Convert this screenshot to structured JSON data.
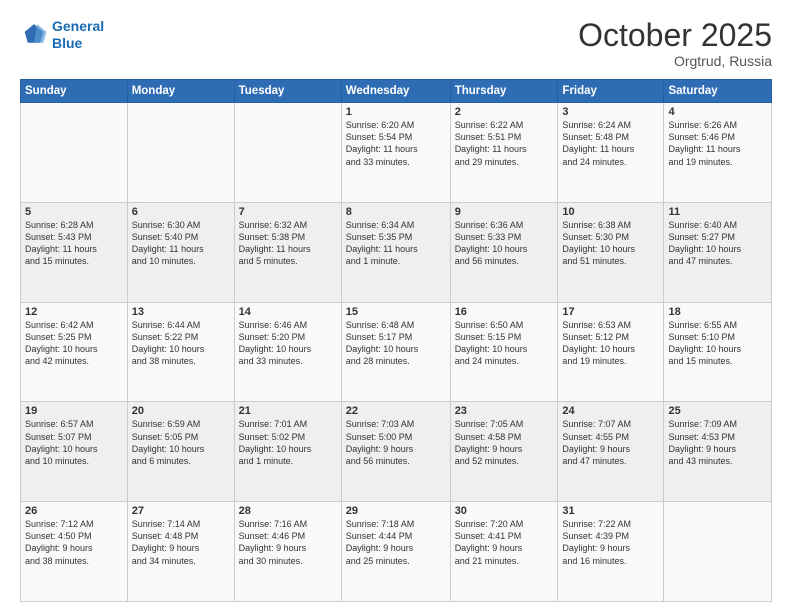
{
  "header": {
    "logo_line1": "General",
    "logo_line2": "Blue",
    "month": "October 2025",
    "location": "Orgtrud, Russia"
  },
  "days_of_week": [
    "Sunday",
    "Monday",
    "Tuesday",
    "Wednesday",
    "Thursday",
    "Friday",
    "Saturday"
  ],
  "weeks": [
    [
      {
        "day": "",
        "text": ""
      },
      {
        "day": "",
        "text": ""
      },
      {
        "day": "",
        "text": ""
      },
      {
        "day": "1",
        "text": "Sunrise: 6:20 AM\nSunset: 5:54 PM\nDaylight: 11 hours\nand 33 minutes."
      },
      {
        "day": "2",
        "text": "Sunrise: 6:22 AM\nSunset: 5:51 PM\nDaylight: 11 hours\nand 29 minutes."
      },
      {
        "day": "3",
        "text": "Sunrise: 6:24 AM\nSunset: 5:48 PM\nDaylight: 11 hours\nand 24 minutes."
      },
      {
        "day": "4",
        "text": "Sunrise: 6:26 AM\nSunset: 5:46 PM\nDaylight: 11 hours\nand 19 minutes."
      }
    ],
    [
      {
        "day": "5",
        "text": "Sunrise: 6:28 AM\nSunset: 5:43 PM\nDaylight: 11 hours\nand 15 minutes."
      },
      {
        "day": "6",
        "text": "Sunrise: 6:30 AM\nSunset: 5:40 PM\nDaylight: 11 hours\nand 10 minutes."
      },
      {
        "day": "7",
        "text": "Sunrise: 6:32 AM\nSunset: 5:38 PM\nDaylight: 11 hours\nand 5 minutes."
      },
      {
        "day": "8",
        "text": "Sunrise: 6:34 AM\nSunset: 5:35 PM\nDaylight: 11 hours\nand 1 minute."
      },
      {
        "day": "9",
        "text": "Sunrise: 6:36 AM\nSunset: 5:33 PM\nDaylight: 10 hours\nand 56 minutes."
      },
      {
        "day": "10",
        "text": "Sunrise: 6:38 AM\nSunset: 5:30 PM\nDaylight: 10 hours\nand 51 minutes."
      },
      {
        "day": "11",
        "text": "Sunrise: 6:40 AM\nSunset: 5:27 PM\nDaylight: 10 hours\nand 47 minutes."
      }
    ],
    [
      {
        "day": "12",
        "text": "Sunrise: 6:42 AM\nSunset: 5:25 PM\nDaylight: 10 hours\nand 42 minutes."
      },
      {
        "day": "13",
        "text": "Sunrise: 6:44 AM\nSunset: 5:22 PM\nDaylight: 10 hours\nand 38 minutes."
      },
      {
        "day": "14",
        "text": "Sunrise: 6:46 AM\nSunset: 5:20 PM\nDaylight: 10 hours\nand 33 minutes."
      },
      {
        "day": "15",
        "text": "Sunrise: 6:48 AM\nSunset: 5:17 PM\nDaylight: 10 hours\nand 28 minutes."
      },
      {
        "day": "16",
        "text": "Sunrise: 6:50 AM\nSunset: 5:15 PM\nDaylight: 10 hours\nand 24 minutes."
      },
      {
        "day": "17",
        "text": "Sunrise: 6:53 AM\nSunset: 5:12 PM\nDaylight: 10 hours\nand 19 minutes."
      },
      {
        "day": "18",
        "text": "Sunrise: 6:55 AM\nSunset: 5:10 PM\nDaylight: 10 hours\nand 15 minutes."
      }
    ],
    [
      {
        "day": "19",
        "text": "Sunrise: 6:57 AM\nSunset: 5:07 PM\nDaylight: 10 hours\nand 10 minutes."
      },
      {
        "day": "20",
        "text": "Sunrise: 6:59 AM\nSunset: 5:05 PM\nDaylight: 10 hours\nand 6 minutes."
      },
      {
        "day": "21",
        "text": "Sunrise: 7:01 AM\nSunset: 5:02 PM\nDaylight: 10 hours\nand 1 minute."
      },
      {
        "day": "22",
        "text": "Sunrise: 7:03 AM\nSunset: 5:00 PM\nDaylight: 9 hours\nand 56 minutes."
      },
      {
        "day": "23",
        "text": "Sunrise: 7:05 AM\nSunset: 4:58 PM\nDaylight: 9 hours\nand 52 minutes."
      },
      {
        "day": "24",
        "text": "Sunrise: 7:07 AM\nSunset: 4:55 PM\nDaylight: 9 hours\nand 47 minutes."
      },
      {
        "day": "25",
        "text": "Sunrise: 7:09 AM\nSunset: 4:53 PM\nDaylight: 9 hours\nand 43 minutes."
      }
    ],
    [
      {
        "day": "26",
        "text": "Sunrise: 7:12 AM\nSunset: 4:50 PM\nDaylight: 9 hours\nand 38 minutes."
      },
      {
        "day": "27",
        "text": "Sunrise: 7:14 AM\nSunset: 4:48 PM\nDaylight: 9 hours\nand 34 minutes."
      },
      {
        "day": "28",
        "text": "Sunrise: 7:16 AM\nSunset: 4:46 PM\nDaylight: 9 hours\nand 30 minutes."
      },
      {
        "day": "29",
        "text": "Sunrise: 7:18 AM\nSunset: 4:44 PM\nDaylight: 9 hours\nand 25 minutes."
      },
      {
        "day": "30",
        "text": "Sunrise: 7:20 AM\nSunset: 4:41 PM\nDaylight: 9 hours\nand 21 minutes."
      },
      {
        "day": "31",
        "text": "Sunrise: 7:22 AM\nSunset: 4:39 PM\nDaylight: 9 hours\nand 16 minutes."
      },
      {
        "day": "",
        "text": ""
      }
    ]
  ]
}
